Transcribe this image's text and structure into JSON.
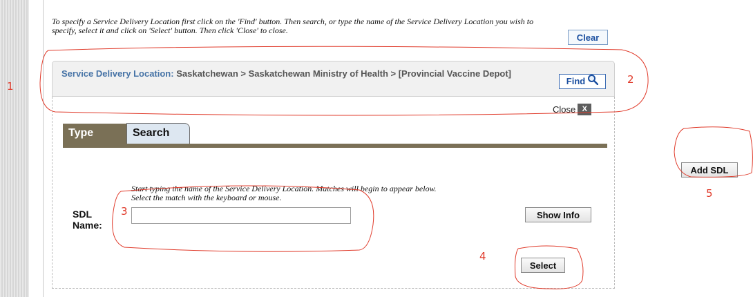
{
  "instructions": {
    "text": "To specify a Service Delivery Location first click on the 'Find' button. Then search, or type the name of the Service Delivery Location you wish to specify, select it and click on 'Select' button. Then click 'Close' to close."
  },
  "toolbar": {
    "clear_label": "Clear",
    "add_sdl_label": "Add SDL"
  },
  "sdl": {
    "label": "Service Delivery Location:",
    "path": "Saskatchewan > Saskatchewan Ministry of Health > [Provincial Vaccine Depot]",
    "find_label": "Find"
  },
  "panel": {
    "close_label": "Close",
    "close_x": "X",
    "tabs": [
      {
        "label": "Type",
        "active": true
      },
      {
        "label": "Search",
        "active": false
      }
    ],
    "hint_line1": "Start typing the name of the Service Delivery Location. Matches will begin to appear below.",
    "hint_line2": "Select the match with the keyboard or mouse.",
    "name_label": "SDL Name:",
    "name_value": "",
    "show_info_label": "Show Info",
    "select_label": "Select"
  },
  "annotations": {
    "n1": "1",
    "n2": "2",
    "n3": "3",
    "n4": "4",
    "n5": "5",
    "color": "#e03a2a"
  },
  "colors": {
    "tab_active_bg": "#7a7056",
    "tab_inactive_bg": "#dde7f1",
    "sdl_label": "#4673a6",
    "link_blue": "#1b4fa0"
  }
}
